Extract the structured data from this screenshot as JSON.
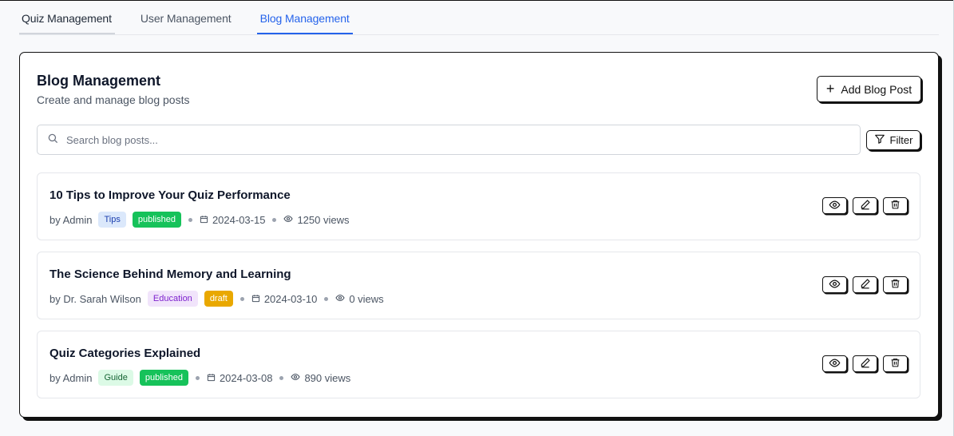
{
  "tabs": [
    {
      "label": "Quiz Management"
    },
    {
      "label": "User Management"
    },
    {
      "label": "Blog Management"
    }
  ],
  "card": {
    "title": "Blog Management",
    "subtitle": "Create and manage blog posts",
    "add_button": "Add Blog Post",
    "search_placeholder": "Search blog posts...",
    "filter_button": "Filter"
  },
  "posts": [
    {
      "title": "10 Tips to Improve Your Quiz Performance",
      "author": "by Admin",
      "category": "Tips",
      "status": "published",
      "date": "2024-03-15",
      "views": "1250 views"
    },
    {
      "title": "The Science Behind Memory and Learning",
      "author": "by Dr. Sarah Wilson",
      "category": "Education",
      "status": "draft",
      "date": "2024-03-10",
      "views": "0 views"
    },
    {
      "title": "Quiz Categories Explained",
      "author": "by Admin",
      "category": "Guide",
      "status": "published",
      "date": "2024-03-08",
      "views": "890 views"
    }
  ],
  "colors": {
    "accent": "#2563eb",
    "published": "#16c25a",
    "draft": "#e9a800",
    "tag_tips_bg": "#dbe8fb",
    "tag_tips_fg": "#1e40af",
    "tag_education_bg": "#f1e4fb",
    "tag_education_fg": "#7e22ce",
    "tag_guide_bg": "#dcfae6",
    "tag_guide_fg": "#166534"
  },
  "icons": {
    "search": "search-icon",
    "filter": "filter-icon",
    "plus": "plus-icon",
    "calendar": "calendar-icon",
    "views": "eye-icon",
    "view_action": "eye-icon",
    "edit_action": "pencil-icon",
    "delete_action": "trash-icon"
  }
}
